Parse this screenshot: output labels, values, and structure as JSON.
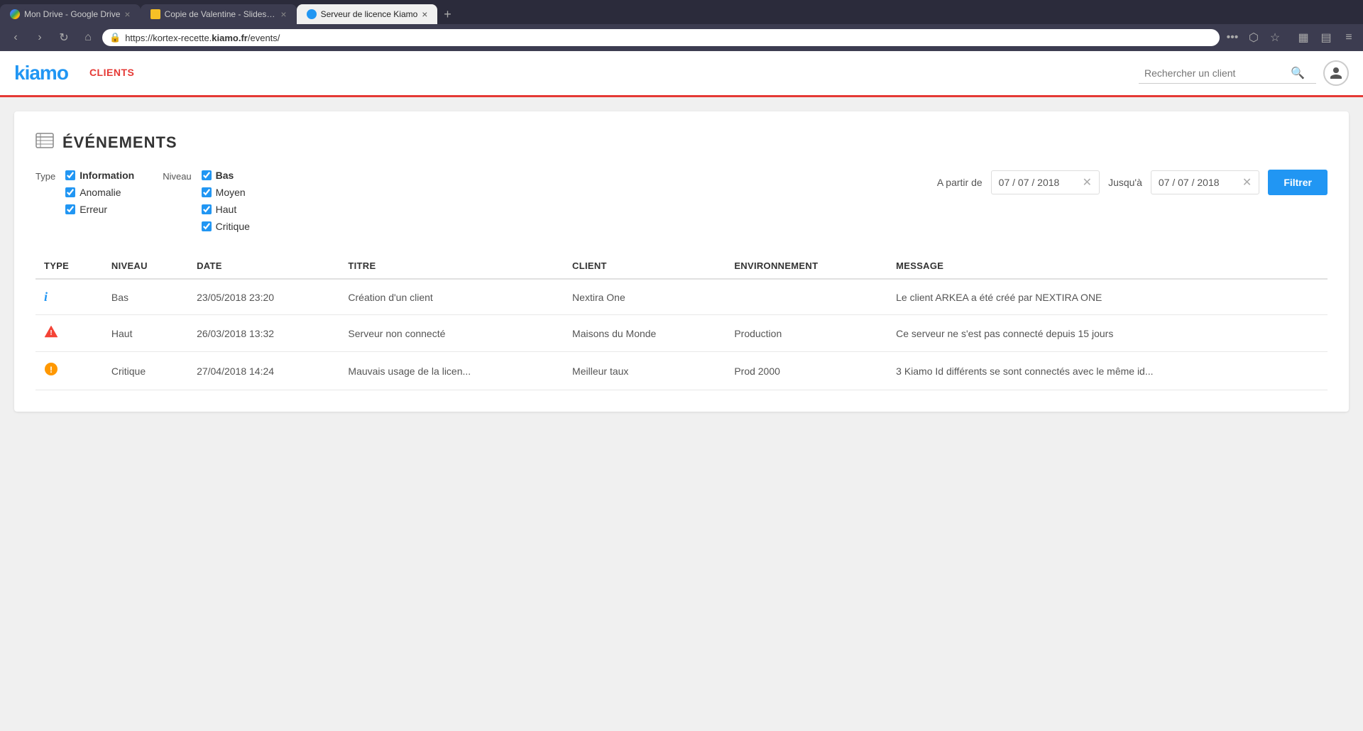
{
  "browser": {
    "tabs": [
      {
        "id": "tab1",
        "title": "Mon Drive - Google Drive",
        "favicon_type": "google",
        "active": false
      },
      {
        "id": "tab2",
        "title": "Copie de Valentine - SlidesCam...",
        "favicon_type": "slides",
        "active": false
      },
      {
        "id": "tab3",
        "title": "Serveur de licence Kiamo",
        "favicon_type": "kiamo",
        "active": true
      }
    ],
    "new_tab_label": "+",
    "url_prefix": "https://kortex-recette.",
    "url_domain": "kiamo.fr",
    "url_path": "/events/",
    "nav": {
      "back": "‹",
      "forward": "›",
      "refresh": "↻",
      "home": "⌂"
    }
  },
  "header": {
    "logo": "kiamo",
    "nav_items": [
      {
        "label": "CLIENTS"
      }
    ],
    "search_placeholder": "Rechercher un client"
  },
  "page": {
    "icon": "≡",
    "title": "ÉVÉNEMENTS",
    "filters": {
      "type_label": "Type",
      "type_options": [
        {
          "label": "Information",
          "checked": true,
          "bold": true
        },
        {
          "label": "Anomalie",
          "checked": true,
          "bold": false
        },
        {
          "label": "Erreur",
          "checked": true,
          "bold": false
        }
      ],
      "level_label": "Niveau",
      "level_options": [
        {
          "label": "Bas",
          "checked": true,
          "bold": true
        },
        {
          "label": "Moyen",
          "checked": true,
          "bold": false
        },
        {
          "label": "Haut",
          "checked": true,
          "bold": false
        },
        {
          "label": "Critique",
          "checked": true,
          "bold": false
        }
      ],
      "from_label": "A partir de",
      "from_date": "07 / 07 / 2018",
      "to_label": "Jusqu'à",
      "to_date": "07 / 07 / 2018",
      "filter_btn": "Filtrer"
    },
    "table": {
      "columns": [
        "TYPE",
        "NIVEAU",
        "DATE",
        "TITRE",
        "CLIENT",
        "ENVIRONNEMENT",
        "MESSAGE"
      ],
      "rows": [
        {
          "type_icon": "info",
          "niveau": "Bas",
          "date": "23/05/2018 23:20",
          "titre": "Création d'un client",
          "client": "Nextira One",
          "environnement": "",
          "message": "Le client ARKEA a été créé par NEXTIRA ONE"
        },
        {
          "type_icon": "warning",
          "niveau": "Haut",
          "date": "26/03/2018 13:32",
          "titre": "Serveur non connecté",
          "client": "Maisons du Monde",
          "environnement": "Production",
          "message": "Ce serveur ne s'est pas connecté depuis 15 jours"
        },
        {
          "type_icon": "critical",
          "niveau": "Critique",
          "date": "27/04/2018 14:24",
          "titre": "Mauvais usage de la licen...",
          "client": "Meilleur taux",
          "environnement": "Prod 2000",
          "message": "3 Kiamo Id différents se sont connectés avec le même id..."
        }
      ]
    }
  }
}
